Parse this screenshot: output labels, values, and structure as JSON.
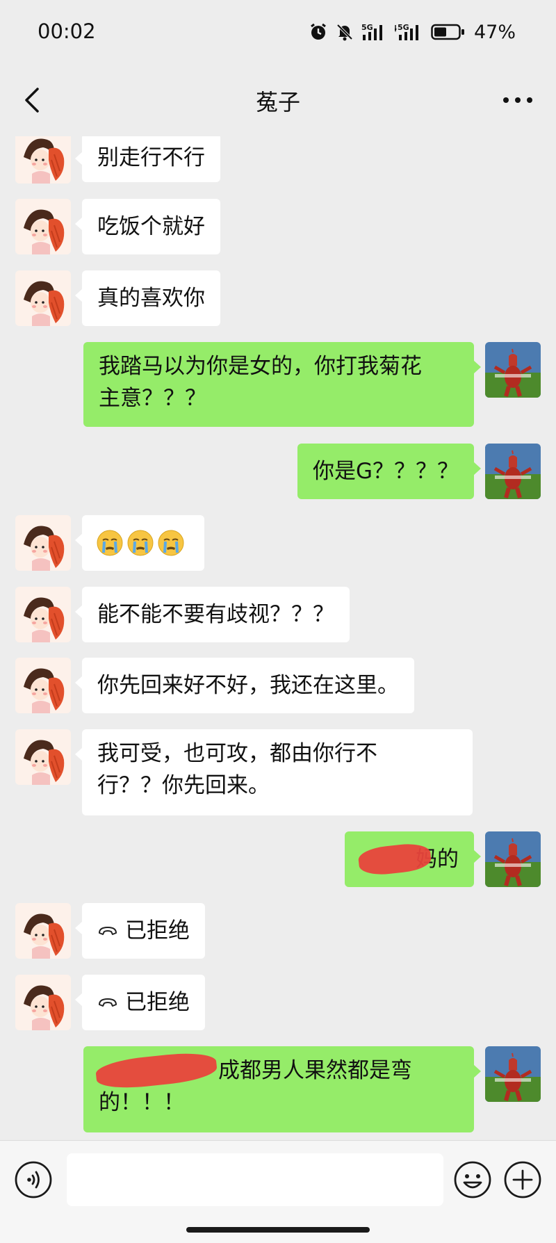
{
  "status_bar": {
    "time": "00:02",
    "battery_percent": "47%",
    "net1": "5G",
    "net2": "5G"
  },
  "header": {
    "title": "菟子"
  },
  "colors": {
    "bubble_out": "#95ec69",
    "bubble_in": "#ffffff",
    "background": "#ededed",
    "redaction": "#e8453c"
  },
  "messages": [
    {
      "side": "in",
      "text": "别走行不行"
    },
    {
      "side": "in",
      "text": "吃饭个就好"
    },
    {
      "side": "in",
      "text": "真的喜欢你"
    },
    {
      "side": "out",
      "lines": [
        "我踏马以为你是女的，你打我菊花",
        "主意？？？"
      ]
    },
    {
      "side": "out",
      "text": "你是G？？？？"
    },
    {
      "side": "in",
      "type": "emoji",
      "emoji": [
        "😭",
        "😭",
        "😭"
      ]
    },
    {
      "side": "in",
      "text": "能不能不要有歧视？？？"
    },
    {
      "side": "in",
      "text": "你先回来好不好，我还在这里。"
    },
    {
      "side": "in",
      "lines": [
        "我可受，也可攻，都由你行不",
        "行？？你先回来。"
      ]
    },
    {
      "side": "out",
      "text": "妈的",
      "redacted": true
    },
    {
      "side": "in",
      "type": "call",
      "text": "已拒绝",
      "icon": "phone-hangup-icon"
    },
    {
      "side": "in",
      "type": "call",
      "text": "已拒绝",
      "icon": "phone-hangup-icon"
    },
    {
      "side": "out",
      "lines": [
        "成都男人果然都是弯",
        "的！！！"
      ],
      "redacted": true
    }
  ]
}
